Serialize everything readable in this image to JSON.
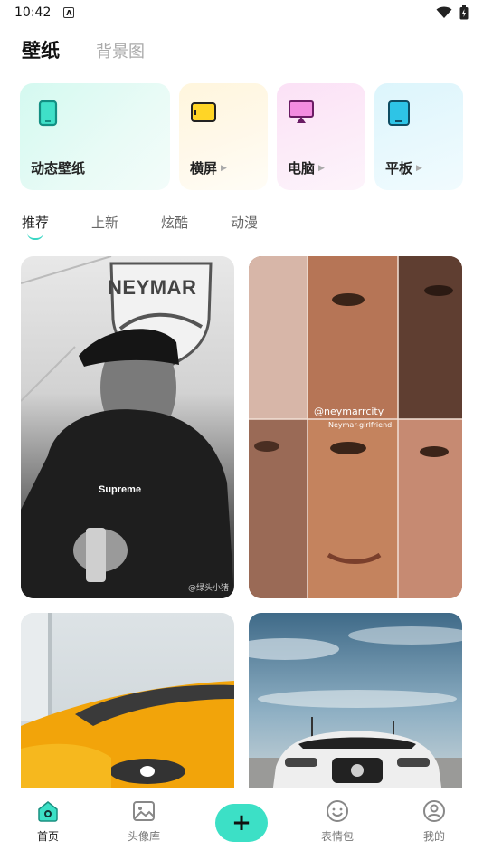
{
  "status_bar": {
    "time": "10:42",
    "notification_icon": "a-icon",
    "icons": [
      "wifi-icon",
      "battery-icon"
    ]
  },
  "top_tabs": [
    {
      "label": "壁纸",
      "active": true
    },
    {
      "label": "背景图",
      "active": false
    }
  ],
  "categories": [
    {
      "label": "动态壁纸",
      "icon": "phone-icon",
      "color": "#1fb8a6"
    },
    {
      "label": "横屏",
      "icon": "landscape-icon",
      "color": "#f1b700"
    },
    {
      "label": "电脑",
      "icon": "monitor-icon",
      "color": "#d94fc0"
    },
    {
      "label": "平板",
      "icon": "tablet-icon",
      "color": "#2aa6cc"
    }
  ],
  "feed_tabs": [
    "推荐",
    "上新",
    "炫酷",
    "动漫"
  ],
  "wallpapers": [
    {
      "name": "neymar-bw-photo",
      "texts": [
        "NEYMAR",
        "Supreme"
      ],
      "watermark": "@绿头小猪"
    },
    {
      "name": "neymar-collage-photo",
      "texts": [
        "@neymarrcity",
        "Neymar-girlfriend"
      ]
    },
    {
      "name": "yellow-car-photo"
    },
    {
      "name": "white-car-photo"
    }
  ],
  "bottom_nav": [
    {
      "label": "首页",
      "icon": "home-icon",
      "active": true
    },
    {
      "label": "头像库",
      "icon": "image-icon",
      "active": false
    },
    {
      "label": "+",
      "icon": "add-icon",
      "active": false
    },
    {
      "label": "表情包",
      "icon": "emoji-icon",
      "active": false
    },
    {
      "label": "我的",
      "icon": "profile-icon",
      "active": false
    }
  ],
  "accent_color": "#3ce0c6"
}
